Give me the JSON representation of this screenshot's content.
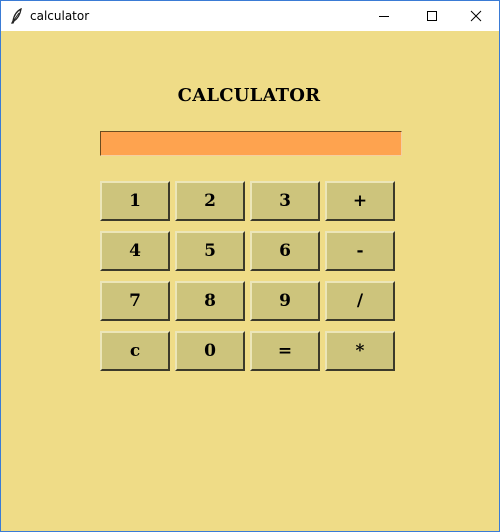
{
  "window": {
    "title": "calculator",
    "icons": {
      "app": "feather-icon",
      "minimize": "minimize-icon",
      "maximize": "maximize-icon",
      "close": "close-icon"
    }
  },
  "app": {
    "heading": "CALCULATOR",
    "display_value": ""
  },
  "keypad": {
    "rows": [
      [
        "1",
        "2",
        "3",
        "+"
      ],
      [
        "4",
        "5",
        "6",
        "-"
      ],
      [
        "7",
        "8",
        "9",
        "/"
      ],
      [
        "c",
        "0",
        "=",
        "*"
      ]
    ]
  },
  "colors": {
    "background": "#efdc87",
    "display": "#fea34f",
    "key": "#cdc47c"
  }
}
